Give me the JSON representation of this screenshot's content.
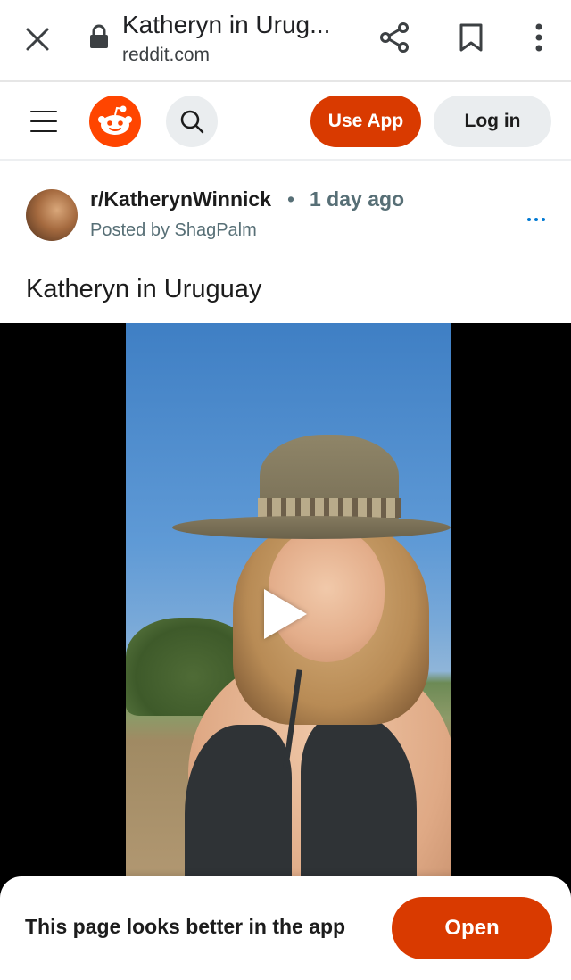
{
  "browser": {
    "tab_title": "Katheryn in Urug...",
    "url": "reddit.com"
  },
  "header": {
    "use_app_label": "Use App",
    "login_label": "Log in"
  },
  "post": {
    "subreddit": "r/KatherynWinnick",
    "separator": "•",
    "time_ago": "1 day ago",
    "posted_by": "Posted by ShagPalm",
    "title": "Katheryn in Uruguay"
  },
  "banner": {
    "text": "This page looks better in the app",
    "open_label": "Open"
  },
  "colors": {
    "brand": "#ff4500",
    "accent_button": "#d93a00",
    "secondary_button": "#eaedef",
    "link_blue": "#0079d3"
  },
  "icons": {
    "close": "close-icon",
    "lock": "lock-icon",
    "share": "share-icon",
    "bookmark": "bookmark-icon",
    "more": "more-vertical-icon",
    "menu": "hamburger-icon",
    "logo": "reddit-logo-icon",
    "search": "search-icon",
    "post_menu": "more-horizontal-icon",
    "play": "play-icon"
  }
}
